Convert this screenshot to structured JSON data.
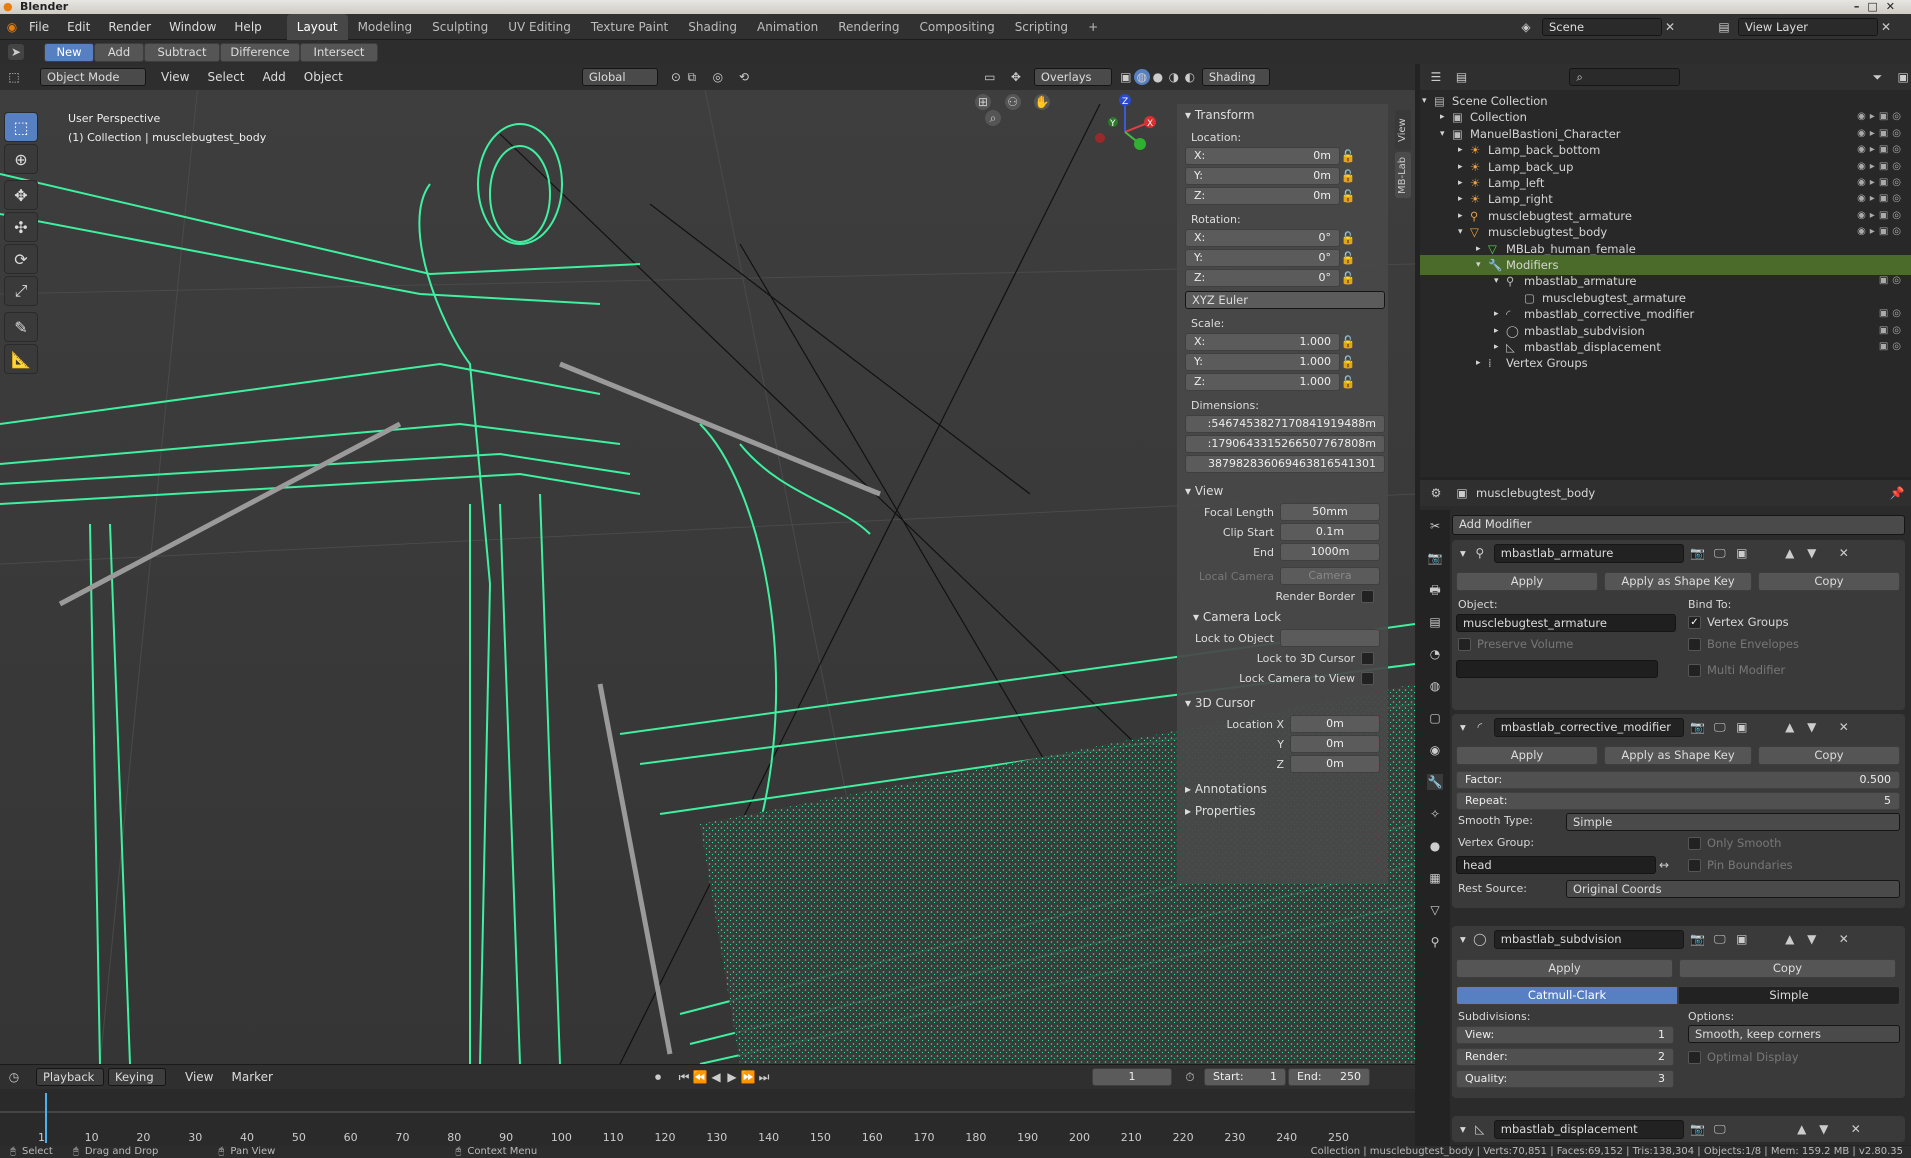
{
  "app": {
    "title": "Blender",
    "logo_icon": "blender-logo-icon"
  },
  "menu": [
    "File",
    "Edit",
    "Render",
    "Window",
    "Help"
  ],
  "workspaces": [
    "Layout",
    "Modeling",
    "Sculpting",
    "UV Editing",
    "Texture Paint",
    "Shading",
    "Animation",
    "Rendering",
    "Compositing",
    "Scripting"
  ],
  "active_workspace": "Layout",
  "scene": {
    "name": "Scene",
    "view_layer": "View Layer"
  },
  "boolean_tools": {
    "new": "New",
    "add": "Add",
    "subtract": "Subtract",
    "difference": "Difference",
    "intersect": "Intersect"
  },
  "viewport": {
    "mode": "Object Mode",
    "menus": [
      "View",
      "Select",
      "Add",
      "Object"
    ],
    "orientation": "Global",
    "overlays": "Overlays",
    "shading": "Shading",
    "info_line1": "User Perspective",
    "info_line2": "(1) Collection | musclebugtest_body",
    "gizmo_axes": {
      "x": "X",
      "y": "Y",
      "z": "Z"
    }
  },
  "npanel": {
    "tabs": {
      "view": "View",
      "mblab": "MB-Lab"
    },
    "transform": {
      "title": "Transform",
      "location_label": "Location:",
      "location": {
        "x": "0m",
        "y": "0m",
        "z": "0m"
      },
      "rotation_label": "Rotation:",
      "rotation": {
        "x": "0°",
        "y": "0°",
        "z": "0°"
      },
      "rotation_mode": "XYZ Euler",
      "scale_label": "Scale:",
      "scale": {
        "x": "1.000",
        "y": "1.000",
        "z": "1.000"
      },
      "dimensions_label": "Dimensions:",
      "dimensions": [
        ":546745382717084191948​8m",
        ":179064331526650776780​8m",
        "387982836069463816541301"
      ]
    },
    "view": {
      "title": "View",
      "focal_length_label": "Focal Length",
      "focal_length": "50mm",
      "clip_start_label": "Clip Start",
      "clip_start": "0.1m",
      "end_label": "End",
      "end": "1000m",
      "local_camera_label": "Local Camera",
      "local_camera": "Camera",
      "render_border_label": "Render Border"
    },
    "camera_lock": {
      "title": "Camera Lock",
      "lock_to_object": "Lock to Object",
      "lock_to_cursor": "Lock to 3D Cursor",
      "lock_camera_to_view": "Lock Camera to View"
    },
    "cursor": {
      "title": "3D Cursor",
      "location_x_label": "Location X",
      "y_label": "Y",
      "z_label": "Z",
      "x": "0m",
      "y": "0m",
      "z": "0m"
    },
    "annotations": "Annotations",
    "properties": "Properties"
  },
  "outliner": {
    "rows": [
      {
        "label": "Scene Collection",
        "indent": 0,
        "icon": "scene-collection-icon"
      },
      {
        "label": "Collection",
        "indent": 1,
        "icon": "collection-icon"
      },
      {
        "label": "ManuelBastioni_Character",
        "indent": 1,
        "icon": "collection-icon"
      },
      {
        "label": "Lamp_back_bottom",
        "indent": 2,
        "icon": "light-icon"
      },
      {
        "label": "Lamp_back_up",
        "indent": 2,
        "icon": "light-icon"
      },
      {
        "label": "Lamp_left",
        "indent": 2,
        "icon": "light-icon"
      },
      {
        "label": "Lamp_right",
        "indent": 2,
        "icon": "light-icon"
      },
      {
        "label": "musclebugtest_armature",
        "indent": 2,
        "icon": "armature-icon"
      },
      {
        "label": "musclebugtest_body",
        "indent": 2,
        "icon": "mesh-icon"
      },
      {
        "label": "MBLab_human_female",
        "indent": 3,
        "icon": "mesh-data-icon"
      },
      {
        "label": "Modifiers",
        "indent": 3,
        "icon": "wrench-icon"
      },
      {
        "label": "mbastlab_armature",
        "indent": 4,
        "icon": "armature-modifier-icon"
      },
      {
        "label": "musclebugtest_armature",
        "indent": 5,
        "icon": "object-icon"
      },
      {
        "label": "mbastlab_corrective_modifier",
        "indent": 4,
        "icon": "corrective-icon"
      },
      {
        "label": "mbastlab_subdvision",
        "indent": 4,
        "icon": "subdivision-icon"
      },
      {
        "label": "mbastlab_displacement",
        "indent": 4,
        "icon": "displace-icon"
      },
      {
        "label": "Vertex Groups",
        "indent": 3,
        "icon": "vertex-groups-icon"
      }
    ]
  },
  "properties": {
    "object_name": "musclebugtest_body",
    "add_modifier": "Add Modifier",
    "apply": "Apply",
    "apply_shape": "Apply as Shape Key",
    "copy": "Copy",
    "armature": {
      "name": "mbastlab_armature",
      "object_label": "Object:",
      "object": "musclebugtest_armature",
      "bind_to": "Bind To:",
      "vertex_groups": "Vertex Groups",
      "preserve_volume": "Preserve Volume",
      "bone_envelopes": "Bone Envelopes",
      "multi_modifier": "Multi Modifier"
    },
    "corrective": {
      "name": "mbastlab_corrective_modifier",
      "factor_label": "Factor:",
      "factor": "0.500",
      "repeat_label": "Repeat:",
      "repeat": "5",
      "smooth_type_label": "Smooth Type:",
      "smooth_type": "Simple",
      "vertex_group_label": "Vertex Group:",
      "only_smooth": "Only Smooth",
      "vertex_group": "head",
      "pin_boundaries": "Pin Boundaries",
      "rest_source_label": "Rest Source:",
      "rest_source": "Original Coords"
    },
    "subdivision": {
      "name": "mbastlab_subdvision",
      "catmull": "Catmull-Clark",
      "simple": "Simple",
      "subdivisions": "Subdivisions:",
      "options": "Options:",
      "view_label": "View:",
      "view": "1",
      "render_label": "Render:",
      "render": "2",
      "quality_label": "Quality:",
      "quality": "3",
      "uv_smooth": "Smooth, keep corners",
      "optimal_display": "Optimal Display"
    },
    "displacement": {
      "name": "mbastlab_displacement"
    }
  },
  "timeline": {
    "playback": "Playback",
    "keying": "Keying",
    "view": "View",
    "marker": "Marker",
    "current_frame": "1",
    "start_label": "Start:",
    "start": "1",
    "end_label": "End:",
    "end": "250",
    "ticks": [
      "1",
      "10",
      "20",
      "30",
      "40",
      "50",
      "60",
      "70",
      "80",
      "90",
      "100",
      "110",
      "120",
      "130",
      "140",
      "150",
      "160",
      "170",
      "180",
      "190",
      "200",
      "210",
      "220",
      "230",
      "240",
      "250"
    ]
  },
  "status": {
    "select": "Select",
    "drag": "Drag and Drop",
    "pan": "Pan View",
    "context": "Context Menu",
    "stats": "Collection | musclebugtest_body | Verts:70,851 | Faces:69,152 | Tris:138,304 | Objects:1/8 | Mem: 159.2 MB | v2.80.35"
  },
  "colors": {
    "accent": "#5680c2",
    "wire": "#3ef0a0",
    "outliner_selected": "#4b6b2a"
  }
}
